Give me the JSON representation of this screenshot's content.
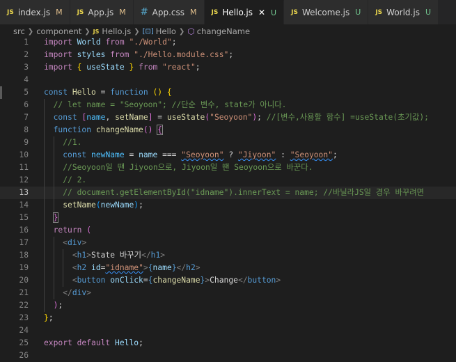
{
  "tabs": [
    {
      "icon": "JS",
      "label": "index.js",
      "status": "M",
      "active": false
    },
    {
      "icon": "JS",
      "label": "App.js",
      "status": "M",
      "active": false
    },
    {
      "icon": "#",
      "label": "App.css",
      "status": "M",
      "active": false
    },
    {
      "icon": "JS",
      "label": "Hello.js",
      "status": "U",
      "active": true,
      "close": "✕"
    },
    {
      "icon": "JS",
      "label": "Welcome.js",
      "status": "U",
      "active": false
    },
    {
      "icon": "JS",
      "label": "World.js",
      "status": "U",
      "active": false
    }
  ],
  "breadcrumb": {
    "src": "src",
    "component": "component",
    "file_badge": "JS",
    "file": "Hello.js",
    "symbol": "Hello",
    "method": "changeName"
  },
  "editor": {
    "current_line": 13,
    "lines": [
      {
        "n": "1",
        "segs": [
          [
            "kw",
            "import"
          ],
          [
            "pu",
            " "
          ],
          [
            "vr",
            "World"
          ],
          [
            "pu",
            " "
          ],
          [
            "kw",
            "from"
          ],
          [
            "pu",
            " "
          ],
          [
            "str",
            "\"./World\""
          ],
          [
            "pu",
            ";"
          ]
        ]
      },
      {
        "n": "2",
        "segs": [
          [
            "kw",
            "import"
          ],
          [
            "pu",
            " "
          ],
          [
            "vr",
            "styles"
          ],
          [
            "pu",
            " "
          ],
          [
            "kw",
            "from"
          ],
          [
            "pu",
            " "
          ],
          [
            "str",
            "\"./Hello.module.css\""
          ],
          [
            "pu",
            ";"
          ]
        ]
      },
      {
        "n": "3",
        "segs": [
          [
            "kw",
            "import"
          ],
          [
            "pu",
            " "
          ],
          [
            "b1",
            "{"
          ],
          [
            "pu",
            " "
          ],
          [
            "vr",
            "useState"
          ],
          [
            "pu",
            " "
          ],
          [
            "b1",
            "}"
          ],
          [
            "pu",
            " "
          ],
          [
            "kw",
            "from"
          ],
          [
            "pu",
            " "
          ],
          [
            "str",
            "\"react\""
          ],
          [
            "pu",
            ";"
          ]
        ]
      },
      {
        "n": "4",
        "segs": []
      },
      {
        "n": "5",
        "segs": [
          [
            "st",
            "const"
          ],
          [
            "pu",
            " "
          ],
          [
            "fn",
            "Hello"
          ],
          [
            "pu",
            " = "
          ],
          [
            "st",
            "function"
          ],
          [
            "pu",
            " "
          ],
          [
            "b1",
            "()"
          ],
          [
            "pu",
            " "
          ],
          [
            "b1",
            "{"
          ]
        ]
      },
      {
        "n": "6",
        "segs": [
          [
            "pu",
            "  "
          ],
          [
            "cm",
            "// let name = \"Seoyoon\"; //단순 변수, state가 아니다."
          ]
        ]
      },
      {
        "n": "7",
        "segs": [
          [
            "pu",
            "  "
          ],
          [
            "st",
            "const"
          ],
          [
            "pu",
            " "
          ],
          [
            "b2",
            "["
          ],
          [
            "cn",
            "name"
          ],
          [
            "pu",
            ", "
          ],
          [
            "fn",
            "setName"
          ],
          [
            "b2",
            "]"
          ],
          [
            "pu",
            " = "
          ],
          [
            "fn",
            "useState"
          ],
          [
            "b2",
            "("
          ],
          [
            "str",
            "\"Seoyoon\""
          ],
          [
            "b2",
            ")"
          ],
          [
            "pu",
            "; "
          ],
          [
            "cm",
            "//[변수,사용할 함수] =useState(초기값);"
          ]
        ]
      },
      {
        "n": "8",
        "segs": [
          [
            "pu",
            "  "
          ],
          [
            "st",
            "function"
          ],
          [
            "pu",
            " "
          ],
          [
            "fn",
            "changeName"
          ],
          [
            "b2",
            "()"
          ],
          [
            "pu",
            " "
          ],
          [
            "b2bx",
            "{"
          ]
        ]
      },
      {
        "n": "9",
        "segs": [
          [
            "pu",
            "    "
          ],
          [
            "cm",
            "//1."
          ]
        ]
      },
      {
        "n": "10",
        "segs": [
          [
            "pu",
            "    "
          ],
          [
            "st",
            "const"
          ],
          [
            "pu",
            " "
          ],
          [
            "cn",
            "newName"
          ],
          [
            "pu",
            " = "
          ],
          [
            "vr",
            "name"
          ],
          [
            "pu",
            " === "
          ],
          [
            "strsq",
            "\"Seoyoon\""
          ],
          [
            "pu",
            " ? "
          ],
          [
            "strsq",
            "\"Jiyoon\""
          ],
          [
            "pu",
            " : "
          ],
          [
            "strsq",
            "\"Seoyoon\""
          ],
          [
            "pu",
            ";"
          ]
        ]
      },
      {
        "n": "11",
        "segs": [
          [
            "pu",
            "    "
          ],
          [
            "cm",
            "//Seoyoon일 땐 Jiyoon으로, Jiyoon일 땐 Seoyoon으로 바꾼다."
          ]
        ]
      },
      {
        "n": "12",
        "segs": [
          [
            "pu",
            "    "
          ],
          [
            "cm",
            "// 2."
          ]
        ]
      },
      {
        "n": "13",
        "segs": [
          [
            "pu",
            "    "
          ],
          [
            "cm",
            "// document.getElementById(\"idname\").innerText = name; //바닐라JS일 경우 바꾸려면"
          ]
        ]
      },
      {
        "n": "14",
        "segs": [
          [
            "pu",
            "    "
          ],
          [
            "fn",
            "setName"
          ],
          [
            "b3",
            "("
          ],
          [
            "vr",
            "newName"
          ],
          [
            "b3",
            ")"
          ],
          [
            "pu",
            ";"
          ]
        ]
      },
      {
        "n": "15",
        "segs": [
          [
            "pu",
            "  "
          ],
          [
            "b2bx",
            "}"
          ]
        ]
      },
      {
        "n": "16",
        "segs": [
          [
            "pu",
            "  "
          ],
          [
            "kw",
            "return"
          ],
          [
            "pu",
            " "
          ],
          [
            "b2",
            "("
          ]
        ]
      },
      {
        "n": "17",
        "segs": [
          [
            "pu",
            "    "
          ],
          [
            "ang",
            "<"
          ],
          [
            "tg",
            "div"
          ],
          [
            "ang",
            ">"
          ]
        ]
      },
      {
        "n": "18",
        "segs": [
          [
            "pu",
            "      "
          ],
          [
            "ang",
            "<"
          ],
          [
            "tg",
            "h1"
          ],
          [
            "ang",
            ">"
          ],
          [
            "pu",
            "State 바꾸기"
          ],
          [
            "ang",
            "</"
          ],
          [
            "tg",
            "h1"
          ],
          [
            "ang",
            ">"
          ]
        ]
      },
      {
        "n": "19",
        "segs": [
          [
            "pu",
            "      "
          ],
          [
            "ang",
            "<"
          ],
          [
            "tg",
            "h2"
          ],
          [
            "pu",
            " "
          ],
          [
            "at",
            "id"
          ],
          [
            "pu",
            "="
          ],
          [
            "strsq",
            "\"idname\""
          ],
          [
            "ang",
            ">"
          ],
          [
            "st",
            "{"
          ],
          [
            "vr",
            "name"
          ],
          [
            "st",
            "}"
          ],
          [
            "ang",
            "</"
          ],
          [
            "tg",
            "h2"
          ],
          [
            "ang",
            ">"
          ]
        ]
      },
      {
        "n": "20",
        "segs": [
          [
            "pu",
            "      "
          ],
          [
            "ang",
            "<"
          ],
          [
            "tg",
            "button"
          ],
          [
            "pu",
            " "
          ],
          [
            "at",
            "onClick"
          ],
          [
            "pu",
            "="
          ],
          [
            "st",
            "{"
          ],
          [
            "fn",
            "changeName"
          ],
          [
            "st",
            "}"
          ],
          [
            "ang",
            ">"
          ],
          [
            "pu",
            "Change"
          ],
          [
            "ang",
            "</"
          ],
          [
            "tg",
            "button"
          ],
          [
            "ang",
            ">"
          ]
        ]
      },
      {
        "n": "21",
        "segs": [
          [
            "pu",
            "    "
          ],
          [
            "ang",
            "</"
          ],
          [
            "tg",
            "div"
          ],
          [
            "ang",
            ">"
          ]
        ]
      },
      {
        "n": "22",
        "segs": [
          [
            "pu",
            "  "
          ],
          [
            "b2",
            ")"
          ],
          [
            "pu",
            ";"
          ]
        ]
      },
      {
        "n": "23",
        "segs": [
          [
            "b1",
            "}"
          ],
          [
            "pu",
            ";"
          ]
        ]
      },
      {
        "n": "24",
        "segs": []
      },
      {
        "n": "25",
        "segs": [
          [
            "kw",
            "export"
          ],
          [
            "pu",
            " "
          ],
          [
            "kw",
            "default"
          ],
          [
            "pu",
            " "
          ],
          [
            "vr",
            "Hello"
          ],
          [
            "pu",
            ";"
          ]
        ]
      },
      {
        "n": "26",
        "segs": []
      }
    ]
  }
}
